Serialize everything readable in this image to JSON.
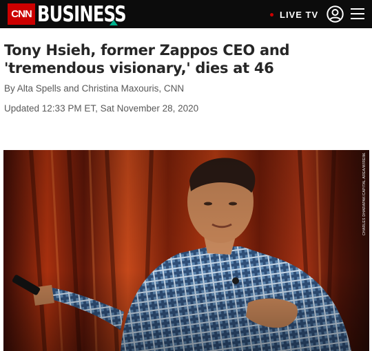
{
  "header": {
    "logo_text": "CNN",
    "section_title": "BUSINESS",
    "live_tv_label": "LIVE TV",
    "icons": [
      "user-account-icon",
      "hamburger-menu-icon"
    ],
    "colors": {
      "bar": "#0c0c0c",
      "brand_red": "#cc0000",
      "accent_green": "#00b28e"
    }
  },
  "article": {
    "headline": "Tony Hsieh, former Zappos CEO and 'tremendous visionary,' dies at 46",
    "byline": "By Alta Spells and Christina Maxouris, CNN",
    "updated": "Updated 12:33 PM ET, Sat November 28, 2020",
    "photo_credit": "CHARLES DHARAPAK/CAPITAL AREA/WIREIMAGE"
  }
}
